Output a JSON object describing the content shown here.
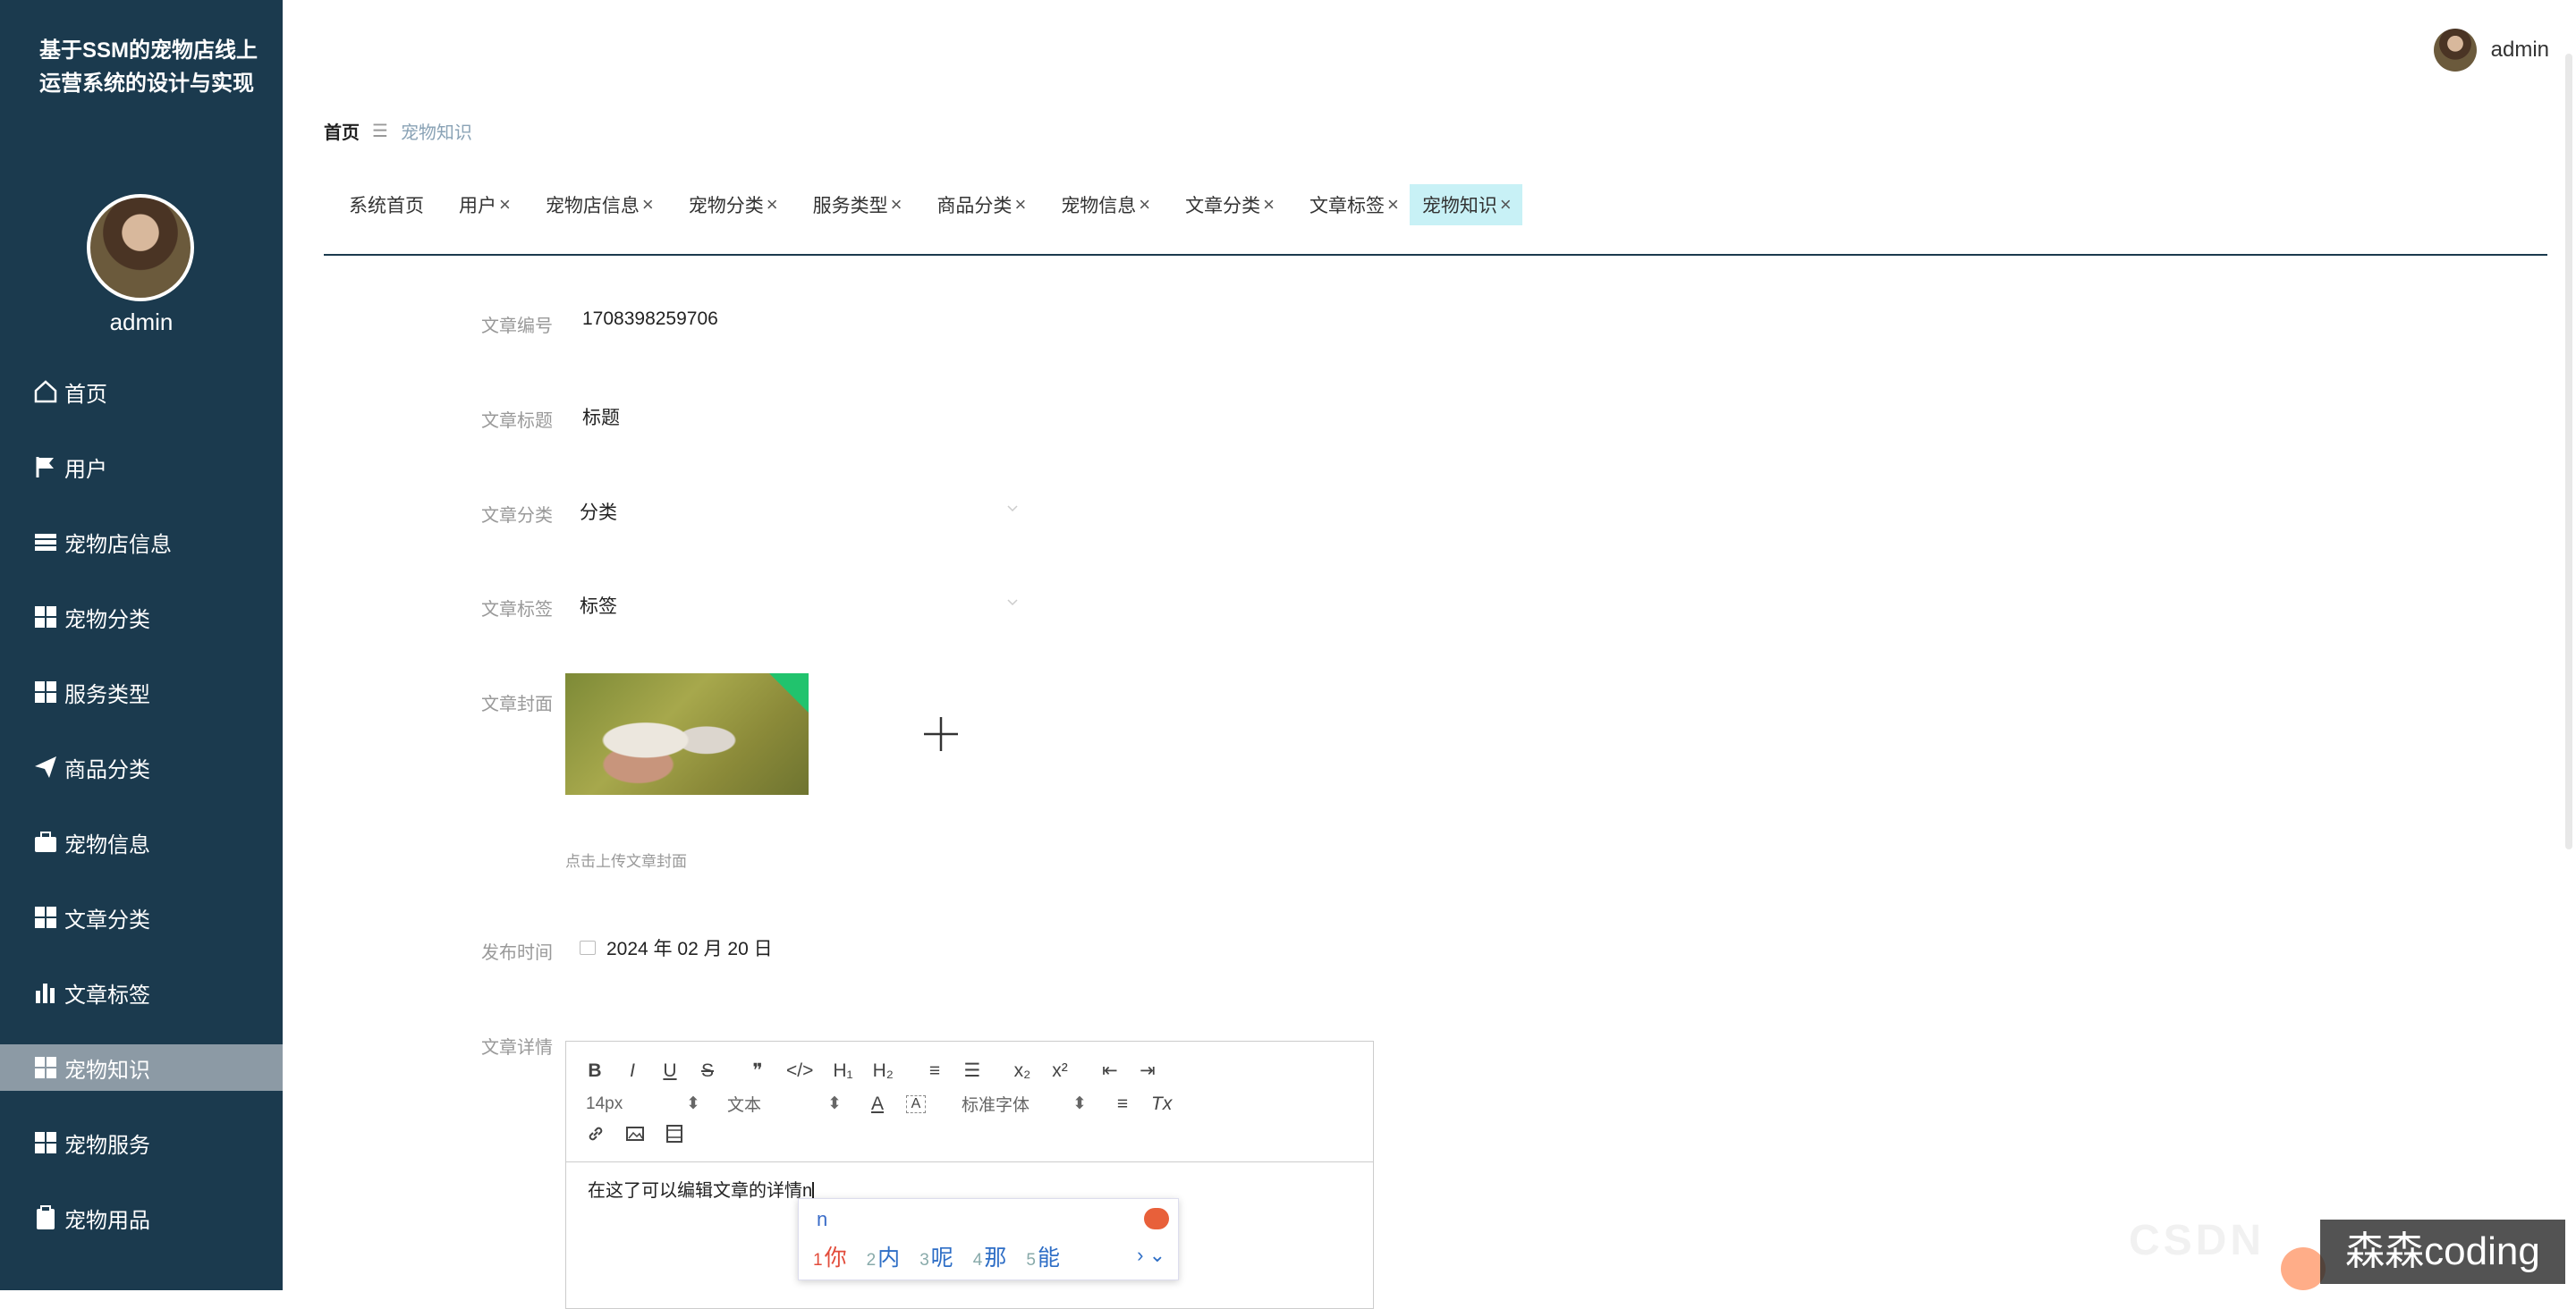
{
  "app": {
    "title": "基于SSM的宠物店线上运营系统的设计与实现"
  },
  "user": {
    "name": "admin"
  },
  "sidebar": {
    "items": [
      {
        "label": "首页",
        "icon": "home-icon"
      },
      {
        "label": "用户",
        "icon": "flag-icon"
      },
      {
        "label": "宠物店信息",
        "icon": "list-icon"
      },
      {
        "label": "宠物分类",
        "icon": "grid-icon"
      },
      {
        "label": "服务类型",
        "icon": "grid-icon"
      },
      {
        "label": "商品分类",
        "icon": "send-icon"
      },
      {
        "label": "宠物信息",
        "icon": "briefcase-icon"
      },
      {
        "label": "文章分类",
        "icon": "grid-icon"
      },
      {
        "label": "文章标签",
        "icon": "bar-chart-icon"
      },
      {
        "label": "宠物知识",
        "icon": "grid-icon",
        "active": true
      },
      {
        "label": "宠物服务",
        "icon": "grid-icon"
      },
      {
        "label": "宠物用品",
        "icon": "clipboard-icon"
      }
    ]
  },
  "breadcrumb": {
    "home": "首页",
    "separator": "☰",
    "current": "宠物知识"
  },
  "tabs": [
    {
      "label": "系统首页",
      "closable": false
    },
    {
      "label": "用户",
      "closable": true
    },
    {
      "label": "宠物店信息",
      "closable": true
    },
    {
      "label": "宠物分类",
      "closable": true
    },
    {
      "label": "服务类型",
      "closable": true
    },
    {
      "label": "商品分类",
      "closable": true
    },
    {
      "label": "宠物信息",
      "closable": true
    },
    {
      "label": "文章分类",
      "closable": true
    },
    {
      "label": "文章标签",
      "closable": true
    },
    {
      "label": "宠物知识",
      "closable": true,
      "active": true
    }
  ],
  "tab_close": "×",
  "form": {
    "article_no": {
      "label": "文章编号",
      "value": "1708398259706"
    },
    "article_title": {
      "label": "文章标题",
      "value": "标题"
    },
    "article_category": {
      "label": "文章分类",
      "value": "分类"
    },
    "article_tag": {
      "label": "文章标签",
      "value": "标签"
    },
    "article_cover": {
      "label": "文章封面",
      "hint": "点击上传文章封面"
    },
    "publish_time": {
      "label": "发布时间",
      "value": "2024 年 02 月 20 日"
    },
    "article_detail": {
      "label": "文章详情",
      "content": "在这了可以编辑文章的详情n"
    }
  },
  "editor": {
    "row1": [
      "B",
      "I",
      "U",
      "S",
      "❞",
      "</>",
      "H₁",
      "H₂",
      "≡",
      "☰",
      "x₂",
      "x²",
      "⇤",
      "⇥"
    ],
    "font_size": "14px",
    "block_type": "文本",
    "font_family": "标准字体",
    "color_btn": "A",
    "bg_btn": "A",
    "align_btn": "≡",
    "clear_btn": "Tx",
    "arrows": "⬍"
  },
  "ime": {
    "input": "n",
    "candidates": [
      {
        "num": "1",
        "text": "你"
      },
      {
        "num": "2",
        "text": "内"
      },
      {
        "num": "3",
        "text": "呢"
      },
      {
        "num": "4",
        "text": "那"
      },
      {
        "num": "5",
        "text": "能"
      }
    ],
    "more": "› ⌄"
  },
  "watermark": {
    "text": "森森coding",
    "faint": "CSDN"
  }
}
